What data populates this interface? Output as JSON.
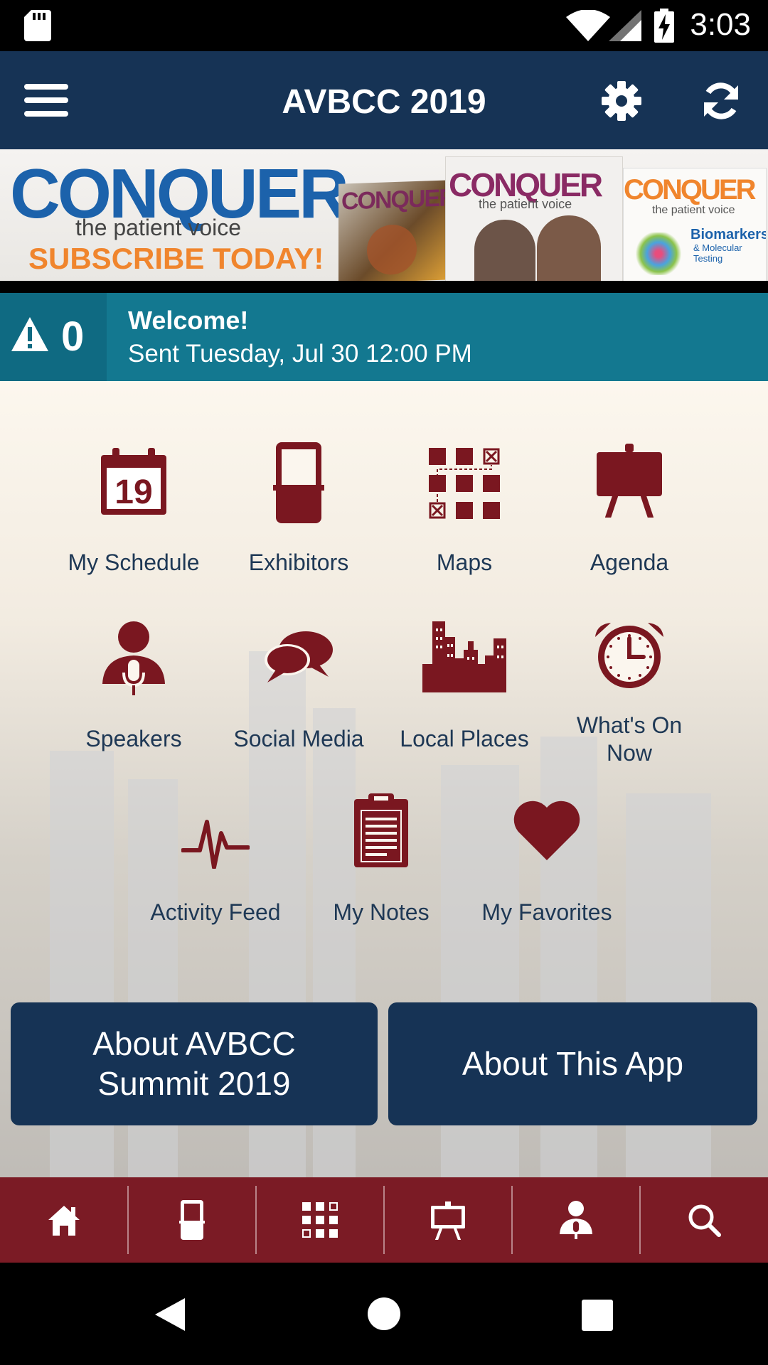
{
  "status_bar": {
    "time": "3:03"
  },
  "app_bar": {
    "title": "AVBCC 2019"
  },
  "banner": {
    "brand": "CONQUER",
    "tagline": "the patient voice",
    "cta": "SUBSCRIBE TODAY!",
    "magazine_1": "CONQUER",
    "magazine_2": "CONQUER",
    "magazine_2_tagline": "the patient voice",
    "magazine_3": "CONQUER",
    "magazine_3_tagline": "the patient voice",
    "magazine_3_headline": "Biomarkers",
    "magazine_3_subhead": "& Molecular Testing"
  },
  "notification": {
    "count": "0",
    "title": "Welcome!",
    "sent": "Sent Tuesday, Jul 30 12:00 PM"
  },
  "grid": {
    "tiles": [
      {
        "label": "My Schedule",
        "icon": "calendar-icon",
        "day": "19"
      },
      {
        "label": "Exhibitors",
        "icon": "booth-icon"
      },
      {
        "label": "Maps",
        "icon": "map-grid-icon"
      },
      {
        "label": "Agenda",
        "icon": "easel-icon"
      },
      {
        "label": "Speakers",
        "icon": "speaker-icon"
      },
      {
        "label": "Social Media",
        "icon": "chat-bubbles-icon"
      },
      {
        "label": "Local Places",
        "icon": "city-skyline-icon"
      },
      {
        "label": "What's On Now",
        "icon": "alarm-clock-icon"
      },
      {
        "label": "Activity Feed",
        "icon": "heartbeat-icon"
      },
      {
        "label": "My Notes",
        "icon": "clipboard-icon"
      },
      {
        "label": "My Favorites",
        "icon": "heart-icon"
      }
    ]
  },
  "buttons": {
    "about_event_line1": "About AVBCC",
    "about_event_line2": "Summit 2019",
    "about_app": "About This App"
  },
  "bottom_nav": {
    "items": [
      "home-icon",
      "booth-icon",
      "map-grid-icon",
      "easel-icon",
      "speaker-icon",
      "search-icon"
    ]
  },
  "colors": {
    "primary": "#163355",
    "accent": "#7b1b25",
    "notice": "#137890",
    "icon": "#7a1720"
  }
}
